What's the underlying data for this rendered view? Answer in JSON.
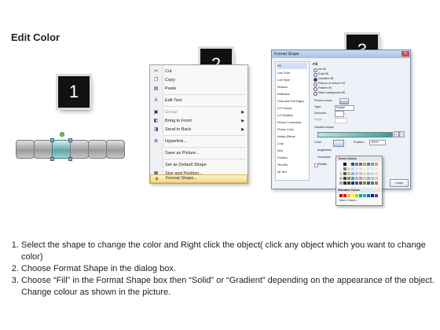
{
  "title": "Edit Color",
  "steps": {
    "badge1": "1",
    "badge2": "2",
    "badge3": "3"
  },
  "context_menu": {
    "items": [
      {
        "label": "Cut",
        "icon": "scissors-icon",
        "glyph": "✂"
      },
      {
        "label": "Copy",
        "icon": "copy-icon",
        "glyph": "❐"
      },
      {
        "label": "Paste",
        "icon": "paste-icon",
        "glyph": "▤"
      },
      {
        "label": "Edit Text",
        "icon": "edit-text-icon",
        "glyph": "A"
      },
      {
        "label": "Group",
        "icon": "group-icon",
        "glyph": "▣",
        "disabled": true,
        "submenu": true
      },
      {
        "label": "Bring to Front",
        "icon": "bring-front-icon",
        "glyph": "◧",
        "submenu": true
      },
      {
        "label": "Send to Back",
        "icon": "send-back-icon",
        "glyph": "◨",
        "submenu": true
      },
      {
        "label": "Hyperlink...",
        "icon": "hyperlink-icon",
        "glyph": "⊕"
      },
      {
        "label": "Save as Picture...",
        "icon": "",
        "glyph": ""
      },
      {
        "label": "Set as Default Shape",
        "icon": "",
        "glyph": ""
      },
      {
        "label": "Size and Position...",
        "icon": "size-icon",
        "glyph": "▦"
      },
      {
        "label": "Format Shape...",
        "icon": "format-shape-icon",
        "glyph": "◆",
        "highlighted": true
      }
    ]
  },
  "dialog": {
    "title": "Format Shape",
    "nav": [
      "Fill",
      "Line Color",
      "Line Style",
      "Shadow",
      "Reflection",
      "Glow and Soft Edges",
      "3-D Format",
      "3-D Rotation",
      "Picture Corrections",
      "Picture Color",
      "Artistic Effects",
      "Crop",
      "Size",
      "Position",
      "Text Box",
      "Alt Text"
    ],
    "section": "Fill",
    "options": [
      "No fill",
      "Solid fill",
      "Gradient fill",
      "Picture or texture fill",
      "Pattern fill",
      "Slide background fill"
    ],
    "labels": {
      "preset": "Preset colors:",
      "type": "Type:",
      "type_value": "Radial",
      "direction": "Direction:",
      "angle": "Angle:",
      "stops": "Gradient stops",
      "color": "Color",
      "position": "Position:",
      "position_value": "100%",
      "brightness": "Brightness",
      "transparency": "Transpare",
      "rotate": "Rotate"
    },
    "close_button": "Close",
    "palette": {
      "theme_header": "Theme Colors",
      "standard_header": "Standard Colors",
      "more": "More Colors..."
    }
  },
  "instructions": [
    "Select the shape to change the color and Right click the object( click any object which you want to change color)",
    "Choose Format Shape in the dialog box.",
    "Choose “Fill” in the Format Shape box then “Solid” or “Gradient” depending on the appearance of the object. Change colour as shown in the picture."
  ],
  "colors": {
    "accent": "#5fa6a6",
    "badge": "#111111",
    "menu_highlight": "#f6d888"
  }
}
